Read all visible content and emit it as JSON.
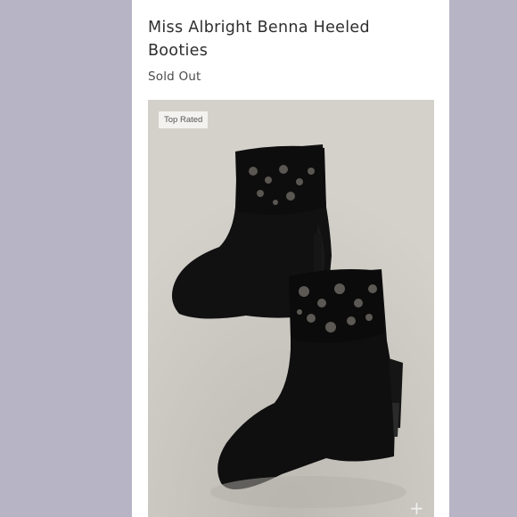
{
  "product": {
    "title": "Miss Albright Benna Heeled Booties",
    "status": "Sold Out",
    "badge": "Top Rated",
    "zoom_symbol": "+"
  },
  "colors": {
    "background": "#b7b5c5",
    "card": "#ffffff",
    "text": "#2e2e2e"
  },
  "icons": {
    "zoom": "plus-icon"
  }
}
